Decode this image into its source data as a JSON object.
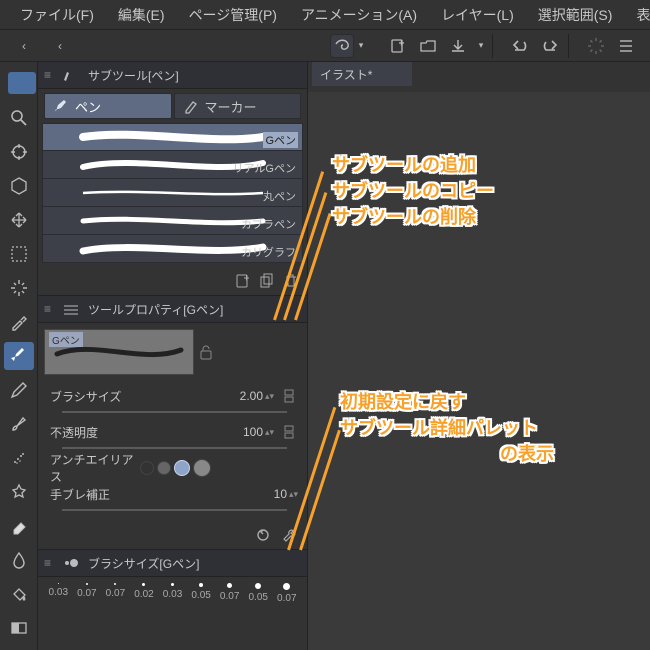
{
  "menubar": [
    "ファイル(F)",
    "編集(E)",
    "ページ管理(P)",
    "アニメーション(A)",
    "レイヤー(L)",
    "選択範囲(S)",
    "表示(V)"
  ],
  "topnav": {
    "chev1": "‹",
    "chev2": "‹"
  },
  "canvas_tab": "イラスト*",
  "subtool": {
    "title": "サブツール[ペン]",
    "tabs": [
      {
        "label": "ペン",
        "sel": true
      },
      {
        "label": "マーカー",
        "sel": false
      }
    ],
    "items": [
      {
        "name": "Gペン",
        "sel": true
      },
      {
        "name": "リアルGペン"
      },
      {
        "name": "丸ペン"
      },
      {
        "name": "カブラペン"
      },
      {
        "name": "カリグラフ"
      }
    ]
  },
  "toolprop": {
    "title": "ツールプロパティ[Gペン]",
    "preview_label": "Gペン",
    "rows": [
      {
        "label": "ブラシサイズ",
        "value": "2.00"
      },
      {
        "label": "不透明度",
        "value": "100"
      },
      {
        "label": "アンチエイリアス"
      },
      {
        "label": "手ブレ補正",
        "value": "10"
      }
    ]
  },
  "brushsize": {
    "title": "ブラシサイズ[Gペン]",
    "items": [
      {
        "d": 1,
        "lbl": "0.03"
      },
      {
        "d": 2,
        "lbl": "0.07"
      },
      {
        "d": 2,
        "lbl": "0.07"
      },
      {
        "d": 3,
        "lbl": "0.02"
      },
      {
        "d": 3,
        "lbl": "0.03"
      },
      {
        "d": 4,
        "lbl": "0.05"
      },
      {
        "d": 5,
        "lbl": "0.07"
      },
      {
        "d": 6,
        "lbl": "0.05"
      },
      {
        "d": 7,
        "lbl": "0.07"
      }
    ]
  },
  "anno": {
    "a1": "サブツールの追加",
    "a2": "サブツールのコピー",
    "a3": "サブツールの削除",
    "b1": "初期設定に戻す",
    "b2": "サブツール詳細パレット",
    "b3": "の表示"
  }
}
